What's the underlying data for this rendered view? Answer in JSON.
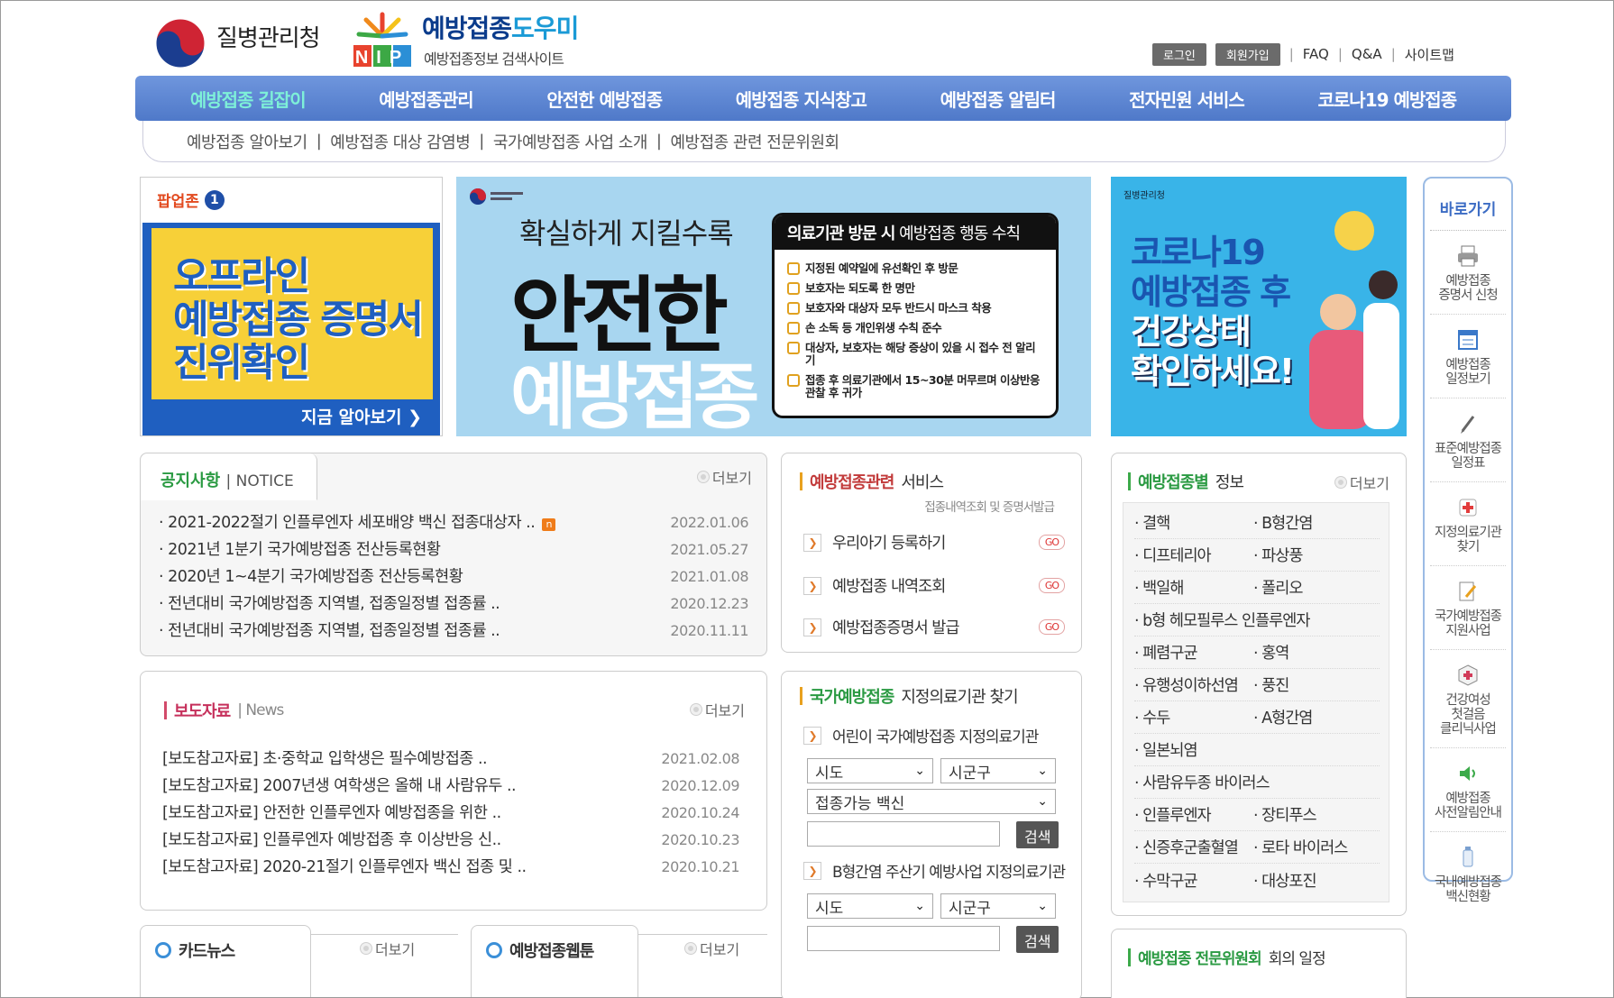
{
  "header": {
    "kdca_name": "질병관리청",
    "nip_title_a": "예방접종",
    "nip_title_b": "도우미",
    "nip_sub": "예방접종정보 검색사이트",
    "nip_logo_text": "NIP",
    "utils": {
      "login": "로그인",
      "join": "회원가입",
      "faq": "FAQ",
      "qna": "Q&A",
      "sitemap": "사이트맵"
    }
  },
  "gnb": [
    "예방접종 길잡이",
    "예방접종관리",
    "안전한 예방접종",
    "예방접종 지식창고",
    "예방접종 알림터",
    "전자민원 서비스",
    "코로나19 예방접종"
  ],
  "subnav": [
    "예방접종 알아보기",
    "예방접종 대상 감염병",
    "국가예방접종 사업 소개",
    "예방접종 관련 전문위원회"
  ],
  "popup": {
    "title": "팝업존",
    "count": "1",
    "lines": [
      "오프라인",
      "예방접종 증명서",
      "진위확인"
    ],
    "more": "지금 알아보기 ❯"
  },
  "mid_banner": {
    "line1": "확실하게 지킬수록",
    "line2": "안전한",
    "line3": "예방접종",
    "rules_title_a": "의료기관 방문 시",
    "rules_title_b": " 예방접종 행동 수칙",
    "rules": [
      "지정된 예약일에 유선확인 후 방문",
      "보호자는 되도록 한 명만",
      "보호자와 대상자 모두 반드시 마스크 착용",
      "손 소독 등 개인위생 수칙 준수",
      "대상자, 보호자는 해당 증상이 있을 시 접수 전 알리기",
      "접종 후 의료기관에서 15~30분 머무르며 이상반응 관찰 후 귀가"
    ]
  },
  "right_banner": {
    "logo": "질병관리청",
    "lines": [
      "코로나19",
      "예방접종 후",
      "건강상태",
      "확인하세요!"
    ]
  },
  "quick": {
    "title": "바로가기",
    "items": [
      {
        "label": "예방접종\n증명서 신청",
        "icon": "printer-icon"
      },
      {
        "label": "예방접종\n일정보기",
        "icon": "calendar-icon"
      },
      {
        "label": "표준예방접종\n일정표",
        "icon": "pen-icon"
      },
      {
        "label": "지정의료기관\n찾기",
        "icon": "hospital-icon"
      },
      {
        "label": "국가예방접종\n지원사업",
        "icon": "edit-icon"
      },
      {
        "label": "건강여성\n첫걸음\n클리닉사업",
        "icon": "first-aid-icon"
      },
      {
        "label": "예방접종\n사전알림안내",
        "icon": "speaker-icon"
      },
      {
        "label": "국내예방접종\n백신현황",
        "icon": "vaccine-icon"
      }
    ]
  },
  "notice": {
    "title": "공지사항",
    "title_en": "NOTICE",
    "more": "더보기",
    "items": [
      {
        "title": "2021-2022절기 인플루엔자 세포배양 백신 접종대상자 ..",
        "date": "2022.01.06",
        "new": "n"
      },
      {
        "title": "2021년 1분기 국가예방접종 전산등록현황",
        "date": "2021.05.27"
      },
      {
        "title": "2020년 1~4분기 국가예방접종 전산등록현황",
        "date": "2021.01.08"
      },
      {
        "title": "전년대비 국가예방접종 지역별, 접종일정별 접종률 ..",
        "date": "2020.12.23"
      },
      {
        "title": "전년대비 국가예방접종 지역별, 접종일정별 접종률 ..",
        "date": "2020.11.11"
      }
    ]
  },
  "press": {
    "title": "보도자료",
    "title_en": "News",
    "more": "더보기",
    "items": [
      {
        "title": "[보도참고자료] 초·중학교 입학생은 필수예방접종 ..",
        "date": "2021.02.08"
      },
      {
        "title": "[보도참고자료] 2007년생 여학생은 올해 내 사람유두 ..",
        "date": "2020.12.09"
      },
      {
        "title": "[보도참고자료] 안전한 인플루엔자 예방접종을 위한 ..",
        "date": "2020.10.24"
      },
      {
        "title": "[보도참고자료] 인플루엔자 예방접종 후 이상반응 신..",
        "date": "2020.10.23"
      },
      {
        "title": "[보도참고자료] 2020-21절기 인플루엔자 백신 접종 및 ..",
        "date": "2020.10.21"
      }
    ]
  },
  "cardnews": {
    "title": "카드뉴스",
    "more": "더보기"
  },
  "webtoon": {
    "title": "예방접종웹툰",
    "more": "더보기"
  },
  "service": {
    "title_a": "예방접종관련",
    "title_b": " 서비스",
    "sub": "접종내역조회 및 증명서발급",
    "go": "GO",
    "items": [
      "우리아기 등록하기",
      "예방접종 내역조회",
      "예방접종증명서 발급"
    ]
  },
  "hospital": {
    "title_a": "국가예방접종",
    "title_b": " 지정의료기관 찾기",
    "child_label": "어린이 국가예방접종 지정의료기관",
    "hepb_label": "B형간염 주산기 예방사업 지정의료기관",
    "sido": "시도",
    "sigungu": "시군구",
    "vaccine": "접종가능 백신",
    "search": "검색"
  },
  "vaccine_info": {
    "title_a": "예방접종별",
    "title_b": " 정보",
    "more": "더보기",
    "rows": [
      [
        "결핵",
        "B형간염"
      ],
      [
        "디프테리아",
        "파상풍"
      ],
      [
        "백일해",
        "폴리오"
      ],
      [
        "b형 헤모필루스 인플루엔자",
        ""
      ],
      [
        "폐렴구균",
        "홍역"
      ],
      [
        "유행성이하선염",
        "풍진"
      ],
      [
        "수두",
        "A형간염"
      ],
      [
        "일본뇌염",
        ""
      ],
      [
        "사람유두종 바이러스",
        ""
      ],
      [
        "인플루엔자",
        "장티푸스"
      ],
      [
        "신증후군출혈열",
        "로타 바이러스"
      ],
      [
        "수막구균",
        "대상포진"
      ]
    ]
  },
  "committee": {
    "title_a": "예방접종 전문위원회",
    "title_b": " 회의 일정"
  },
  "colors": {
    "gnb": "#5b84d2",
    "green": "#2a9a42",
    "red": "#c62f5b"
  }
}
